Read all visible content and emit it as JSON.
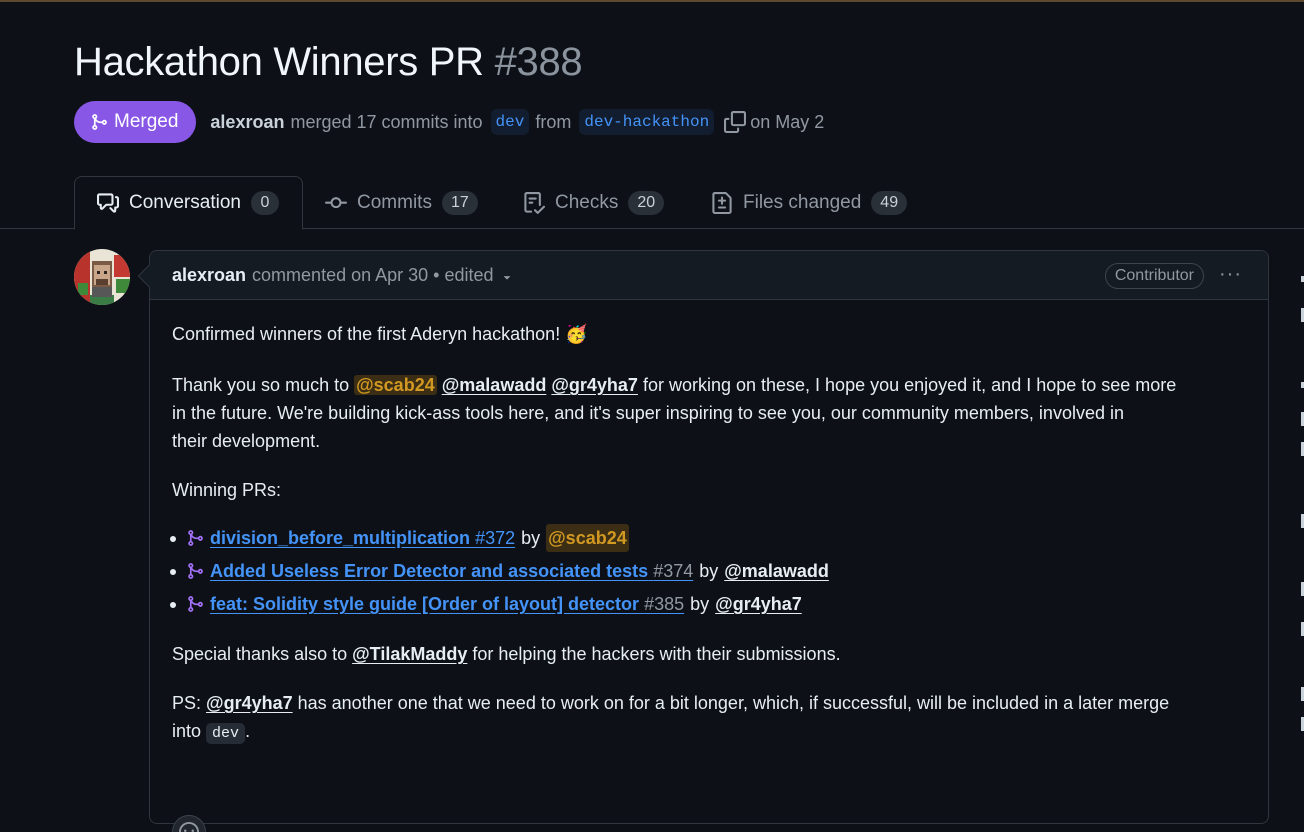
{
  "pr": {
    "title": "Hackathon Winners PR",
    "number": "#388",
    "status": "Merged",
    "author": "alexroan",
    "merge_text": "merged 17 commits into",
    "base_branch": "dev",
    "from_text": "from",
    "head_branch": "dev-hackathon",
    "date_text": "on May 2"
  },
  "tabs": [
    {
      "label": "Conversation",
      "count": "0",
      "icon": "comment-discussion-icon"
    },
    {
      "label": "Commits",
      "count": "17",
      "icon": "git-commit-icon"
    },
    {
      "label": "Checks",
      "count": "20",
      "icon": "checklist-icon"
    },
    {
      "label": "Files changed",
      "count": "49",
      "icon": "file-diff-icon"
    }
  ],
  "comment": {
    "author": "alexroan",
    "meta": "commented on Apr 30 • edited",
    "role_badge": "Contributor",
    "line1": "Confirmed winners of the first Aderyn hackathon! 🥳",
    "thanks": {
      "prefix": "Thank you so much to",
      "m1": "@scab24",
      "m2": "@malawadd",
      "m3": "@gr4yha7",
      "suffix_line1": "for working on these, I hope you enjoyed it, and I hope to see more",
      "line2": "in the future. We're building kick-ass tools here, and it's super inspiring to see you, our community members, involved in",
      "line3": "their development."
    },
    "winning_label": "Winning PRs:",
    "prs": [
      {
        "title": "division_before_multiplication",
        "number": "#372",
        "by": "by",
        "user": "@scab24"
      },
      {
        "title": "Added Useless Error Detector and associated tests",
        "number": "#374",
        "by": "by",
        "user": "@malawadd"
      },
      {
        "title": "feat: Solidity style guide [Order of layout] detector",
        "number": "#385",
        "by": "by",
        "user": "@gr4yha7"
      }
    ],
    "special": {
      "prefix": "Special thanks also to",
      "user": "@TilakMaddy",
      "suffix": "for helping the hackers with their submissions."
    },
    "ps": {
      "prefix": "PS:",
      "user": "@gr4yha7",
      "line1": "has another one that we need to work on for a bit longer, which, if successful, will be included in a later merge",
      "line2_prefix": "into",
      "code": "dev",
      "line2_suffix": "."
    }
  },
  "colors": {
    "background": "#0d1117",
    "merged": "#8957e5",
    "link": "#4493f8",
    "mention_highlight": "#d29922"
  }
}
